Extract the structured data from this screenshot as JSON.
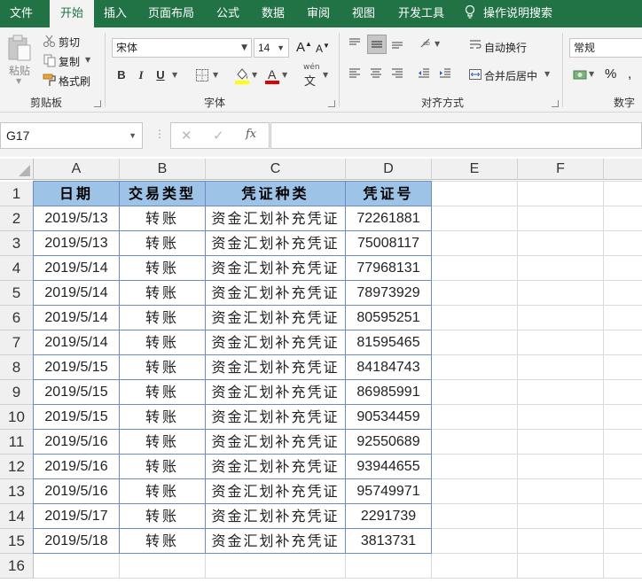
{
  "menu": {
    "tabs": [
      "文件",
      "开始",
      "插入",
      "页面布局",
      "公式",
      "数据",
      "审阅",
      "视图",
      "开发工具"
    ],
    "active_tab": "开始",
    "search_label": "操作说明搜索"
  },
  "ribbon": {
    "clipboard": {
      "paste": "粘贴",
      "cut": "剪切",
      "copy": "复制",
      "format_painter": "格式刷",
      "group_label": "剪贴板"
    },
    "font": {
      "font_name": "宋体",
      "font_size": "14",
      "grow": "A",
      "shrink": "A",
      "bold": "B",
      "italic": "I",
      "underline": "U",
      "phonetic": "wén",
      "phonetic_sub": "文",
      "group_label": "字体"
    },
    "alignment": {
      "wrap_text": "自动换行",
      "merge_center": "合并后居中",
      "group_label": "对齐方式"
    },
    "number": {
      "format": "常规",
      "percent": "%",
      "group_label": "数字"
    }
  },
  "formula_bar": {
    "name_box": "G17",
    "cancel": "✕",
    "enter": "✓",
    "fx": "fx",
    "formula": ""
  },
  "sheet": {
    "columns": [
      "A",
      "B",
      "C",
      "D",
      "E",
      "F"
    ],
    "rows": [
      "1",
      "2",
      "3",
      "4",
      "5",
      "6",
      "7",
      "8",
      "9",
      "10",
      "11",
      "12",
      "13",
      "14",
      "15",
      "16"
    ],
    "header": [
      "日期",
      "交易类型",
      "凭证种类",
      "凭证号"
    ],
    "data": [
      [
        "2019/5/13",
        "转账",
        "资金汇划补充凭证",
        "72261881"
      ],
      [
        "2019/5/13",
        "转账",
        "资金汇划补充凭证",
        "75008117"
      ],
      [
        "2019/5/14",
        "转账",
        "资金汇划补充凭证",
        "77968131"
      ],
      [
        "2019/5/14",
        "转账",
        "资金汇划补充凭证",
        "78973929"
      ],
      [
        "2019/5/14",
        "转账",
        "资金汇划补充凭证",
        "80595251"
      ],
      [
        "2019/5/14",
        "转账",
        "资金汇划补充凭证",
        "81595465"
      ],
      [
        "2019/5/15",
        "转账",
        "资金汇划补充凭证",
        "84184743"
      ],
      [
        "2019/5/15",
        "转账",
        "资金汇划补充凭证",
        "86985991"
      ],
      [
        "2019/5/15",
        "转账",
        "资金汇划补充凭证",
        "90534459"
      ],
      [
        "2019/5/16",
        "转账",
        "资金汇划补充凭证",
        "92550689"
      ],
      [
        "2019/5/16",
        "转账",
        "资金汇划补充凭证",
        "93944655"
      ],
      [
        "2019/5/16",
        "转账",
        "资金汇划补充凭证",
        "95749971"
      ],
      [
        "2019/5/17",
        "转账",
        "资金汇划补充凭证",
        "2291739"
      ],
      [
        "2019/5/18",
        "转账",
        "资金汇划补充凭证",
        "3813731"
      ]
    ]
  },
  "colors": {
    "title_bar": "#217346",
    "header_fill": "#9dc3e6",
    "table_border": "#5b7fb9"
  }
}
